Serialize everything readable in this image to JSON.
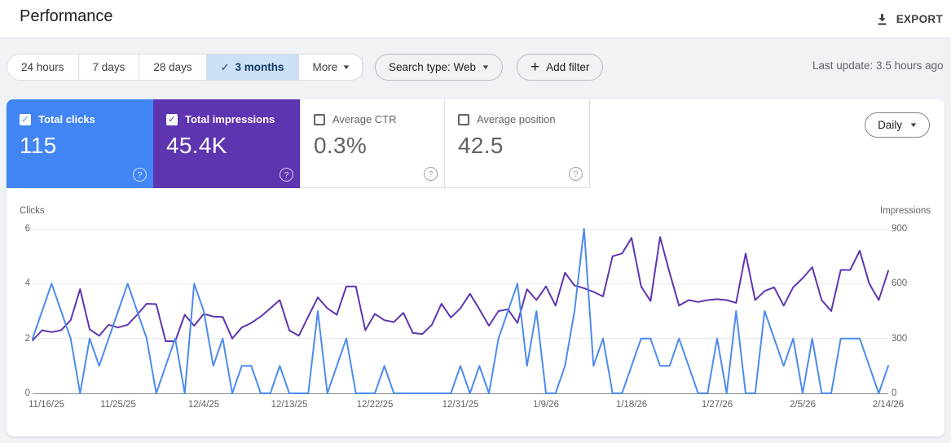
{
  "header": {
    "title": "Performance",
    "export_label": "EXPORT"
  },
  "filters": {
    "date_ranges": [
      {
        "label": "24 hours",
        "selected": false
      },
      {
        "label": "7 days",
        "selected": false
      },
      {
        "label": "28 days",
        "selected": false
      },
      {
        "label": "3 months",
        "selected": true
      },
      {
        "label": "More",
        "selected": false,
        "caret": true
      }
    ],
    "search_type_label": "Search type: Web",
    "add_filter_label": "Add filter",
    "last_update": "Last update: 3.5 hours ago",
    "selected_chip_bg": "#cce0f7",
    "selected_chip_text": "#123a66"
  },
  "metrics": {
    "tiles": [
      {
        "label": "Total clicks",
        "value": "115",
        "checked": true,
        "bg": "#4285f4"
      },
      {
        "label": "Total impressions",
        "value": "45.4K",
        "checked": true,
        "bg": "#5e35b1"
      },
      {
        "label": "Average CTR",
        "value": "0.3%",
        "checked": false,
        "bg": "#ffffff"
      },
      {
        "label": "Average position",
        "value": "42.5",
        "checked": false,
        "bg": "#ffffff"
      }
    ],
    "granularity_label": "Daily",
    "help_icon_glyph": "?"
  },
  "chart_data": {
    "type": "line",
    "x_tick_labels": [
      "11/16/25",
      "11/25/25",
      "12/4/25",
      "12/13/25",
      "12/22/25",
      "12/31/25",
      "1/9/26",
      "1/18/26",
      "1/27/26",
      "2/5/26",
      "2/14/26"
    ],
    "left_axis": {
      "label": "Clicks",
      "ticks": [
        0,
        2,
        4,
        6
      ],
      "max": 6
    },
    "right_axis": {
      "label": "Impressions",
      "ticks": [
        0,
        300,
        600,
        900
      ],
      "max": 900
    },
    "grid": true,
    "legend_position": "none",
    "series": [
      {
        "name": "Clicks",
        "axis": "left",
        "color": "#4b8bee",
        "values": [
          2,
          3,
          4,
          3,
          2,
          0,
          2,
          1,
          2,
          3,
          4,
          3,
          2,
          0,
          1,
          2,
          0,
          4,
          3,
          1,
          2,
          0,
          1,
          1,
          0,
          0,
          1,
          0,
          0,
          0,
          3,
          0,
          1,
          2,
          0,
          0,
          0,
          1,
          0,
          0,
          0,
          0,
          0,
          0,
          0,
          1,
          0,
          1,
          0,
          2,
          3,
          4,
          1,
          3,
          0,
          0,
          1,
          3,
          6,
          1,
          2,
          0,
          0,
          1,
          2,
          2,
          1,
          1,
          2,
          1,
          0,
          0,
          2,
          0,
          3,
          0,
          0,
          3,
          2,
          1,
          2,
          0,
          2,
          0,
          0,
          2,
          2,
          2,
          1,
          0,
          1
        ]
      },
      {
        "name": "Impressions",
        "axis": "right",
        "color": "#5e35b1",
        "values": [
          290,
          345,
          335,
          345,
          400,
          570,
          350,
          315,
          375,
          360,
          375,
          430,
          490,
          488,
          285,
          285,
          430,
          370,
          435,
          420,
          418,
          300,
          360,
          385,
          420,
          465,
          510,
          345,
          315,
          420,
          525,
          465,
          430,
          585,
          585,
          345,
          435,
          400,
          390,
          440,
          330,
          325,
          375,
          490,
          415,
          465,
          545,
          460,
          370,
          450,
          460,
          385,
          570,
          510,
          585,
          480,
          660,
          590,
          575,
          555,
          530,
          750,
          765,
          850,
          585,
          505,
          855,
          660,
          480,
          510,
          500,
          510,
          515,
          510,
          495,
          765,
          510,
          560,
          580,
          480,
          580,
          630,
          690,
          510,
          450,
          675,
          675,
          780,
          600,
          510,
          670
        ]
      }
    ]
  }
}
